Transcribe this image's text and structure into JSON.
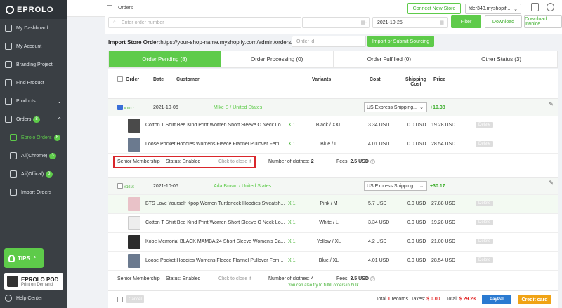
{
  "brand": {
    "logo_text": "EPROLO"
  },
  "sidebar": {
    "items": [
      {
        "label": "My Dashboard"
      },
      {
        "label": "My Account"
      },
      {
        "label": "Branding Project"
      },
      {
        "label": "Find Product"
      },
      {
        "label": "Products"
      },
      {
        "label": "Orders",
        "badge": "8"
      },
      {
        "label": "Eprolo Orders",
        "badge": "8"
      },
      {
        "label": "Ali(Chrome)",
        "badge": "3"
      },
      {
        "label": "Ali(Offical)",
        "badge": "3"
      },
      {
        "label": "Import Orders"
      }
    ],
    "tips_label": "TIPS",
    "pod_title": "EPROLO POD",
    "pod_subtitle": "Print on Demand",
    "help_label": "Help Center"
  },
  "topbar": {
    "title": "Orders",
    "connect_label": "Connect New Store",
    "store_value": "fder343.myshopif..."
  },
  "filters": {
    "order_placeholder": "Enter order number",
    "date_to": "2021-10-25",
    "date_sep": "-",
    "filter_label": "Filter",
    "download_label": "Download",
    "download_invoice_label": "Download Invoice"
  },
  "import": {
    "label": "Import Store Order:",
    "url": "https://your-shop-name.myshopify.com/admin/orders/",
    "placeholder": "Order id",
    "button_label": "Import or Submit Sourcing"
  },
  "tabs": [
    {
      "label": "Order Pending (8)"
    },
    {
      "label": "Order Processing (0)"
    },
    {
      "label": "Order Fulfilled (0)"
    },
    {
      "label": "Other Status (3)"
    }
  ],
  "columns": {
    "order": "Order",
    "date": "Date",
    "customer": "Customer",
    "variants": "Variants",
    "cost": "Cost",
    "shipping_line1": "Shipping",
    "shipping_line2": "Cost",
    "price": "Price"
  },
  "orders": [
    {
      "id": "#1017",
      "date": "2021-10-06",
      "customer": "Mike S  / United States",
      "shipping": "US Express Shipping...",
      "total": "+19.38",
      "items": [
        {
          "name": "Cotton T Shirt Bee Kind Print Women Short Sleeve O Neck Lo...",
          "qty": "X 1",
          "variant": "Black / XXL",
          "cost": "3.34 USD",
          "ship": "0.0 USD",
          "price": "19.28 USD",
          "del": "Delete"
        },
        {
          "name": "Loose Pocket Hoodies Womens Fleece Flannel Pullover Fem...",
          "qty": "X 1",
          "variant": "Blue / L",
          "cost": "4.01 USD",
          "ship": "0.0 USD",
          "price": "28.54 USD",
          "del": "Delete"
        }
      ],
      "membership": "Senior Membership",
      "status": "Status: Enabled",
      "close": "Click to close it",
      "clothes_label": "Number of clothes:",
      "clothes": "2",
      "fees_label": "Fees:",
      "fees": "2.5 USD"
    },
    {
      "id": "#1016",
      "date": "2021-10-06",
      "customer": "Ada Brown  / United States",
      "shipping": "US Express Shipping...",
      "total": "+30.17",
      "items": [
        {
          "name": "BTS Love Yourself Kpop Women Turtleneck Hoodies Sweatsh...",
          "qty": "X 1",
          "variant": "Pink / M",
          "cost": "5.7 USD",
          "ship": "0.0 USD",
          "price": "27.88 USD",
          "del": "Delete"
        },
        {
          "name": "Cotton T Shirt Bee Kind Print Women Short Sleeve O Neck Lo...",
          "qty": "X 1",
          "variant": "White / L",
          "cost": "3.34 USD",
          "ship": "0.0 USD",
          "price": "19.28 USD",
          "del": "Delete"
        },
        {
          "name": "Kobe Memorial BLACK MAMBA 24 Short Sleeve Women's Ca...",
          "qty": "X 1",
          "variant": "Yellow / XL",
          "cost": "4.2 USD",
          "ship": "0.0 USD",
          "price": "21.00 USD",
          "del": "Delete"
        },
        {
          "name": "Loose Pocket Hoodies Womens Fleece Flannel Pullover Fem...",
          "qty": "X 1",
          "variant": "Blue / XL",
          "cost": "4.01 USD",
          "ship": "0.0 USD",
          "price": "28.54 USD",
          "del": "Delete"
        }
      ],
      "membership": "Senior Membership",
      "status": "Status: Enabled",
      "close": "Click to close it",
      "clothes_label": "Number of clothes:",
      "clothes": "4",
      "fees_label": "Fees:",
      "fees": "3.5 USD"
    }
  ],
  "bulk_hint": "You can also try to fulfill orders in bulk.",
  "footer": {
    "cancel_label": "Cancel",
    "total_prefix": "Total",
    "total_count": "1",
    "total_suffix": "records",
    "taxes_label": "Taxes:",
    "taxes_value": "$ 0.00",
    "total_label": "Total:",
    "total_value": "$ 29.23",
    "paypal_label": "PayPal",
    "credit_label": "Credit card"
  },
  "colors": {
    "accent": "#5ecb4a",
    "sidebar": "#3a3f44",
    "alert": "#d9262b",
    "paypal": "#2a7ad1",
    "credit": "#f0a315"
  }
}
